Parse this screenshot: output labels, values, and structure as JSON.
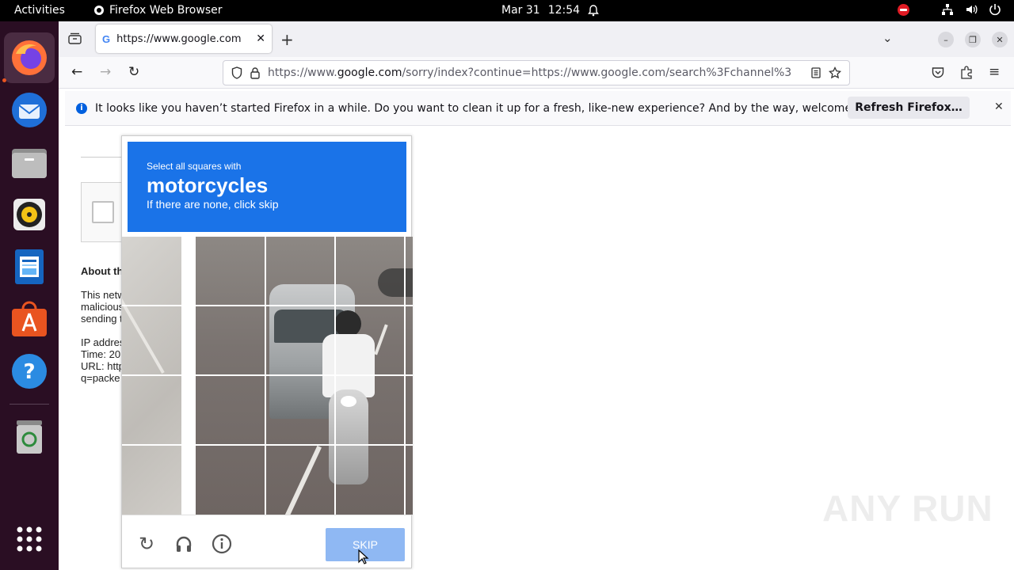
{
  "topbar": {
    "activities": "Activities",
    "app_name": "Firefox Web Browser",
    "date": "Mar 31",
    "time": "12:54"
  },
  "dock": {
    "items": [
      "firefox",
      "thunderbird",
      "files",
      "rhythmbox",
      "libreoffice-writer",
      "app-center",
      "help",
      "trash",
      "show-apps"
    ]
  },
  "browser": {
    "tab_title": "https://www.google.com",
    "url_prefix": "https://www.",
    "url_domain": "google.com",
    "url_rest": "/sorry/index?continue=https://www.google.com/search%3Fchannel%3",
    "notice_text": "It looks like you haven’t started Firefox in a while. Do you want to clean it up for a fresh, like-new experience? And by the way, welcome back!",
    "refresh_label": "Refresh Firefox…"
  },
  "page": {
    "about_title": "About th",
    "para1_lines": [
      "This netw",
      "malicious",
      "sending t"
    ],
    "para2_lines": [
      "IP addres",
      "Time: 20",
      "URL: http",
      "q=packe"
    ]
  },
  "challenge": {
    "instruction_small": "Select all squares with",
    "instruction_big": "motorcycles",
    "instruction_sub": "If there are none, click skip",
    "skip_label": "SKIP"
  },
  "watermark": "ANY RUN",
  "colors": {
    "challenge_blue": "#1a73e8",
    "skip_disabled": "#8fb8f3",
    "dock_bg": "#2a0e23",
    "accent_orange": "#e95420"
  }
}
